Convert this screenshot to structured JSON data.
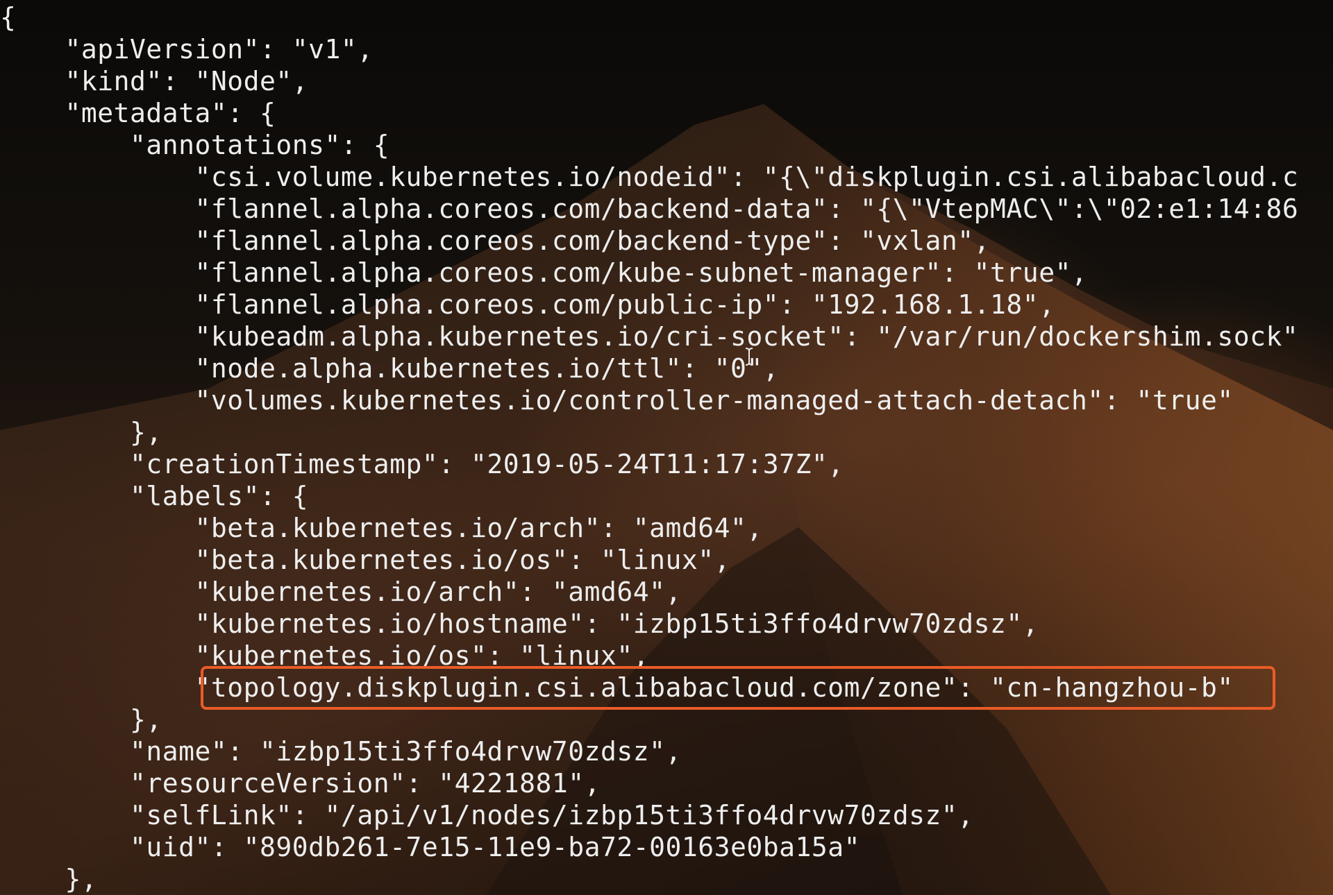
{
  "terminal": {
    "lines": [
      "{",
      "    \"apiVersion\": \"v1\",",
      "    \"kind\": \"Node\",",
      "    \"metadata\": {",
      "        \"annotations\": {",
      "            \"csi.volume.kubernetes.io/nodeid\": \"{\\\"diskplugin.csi.alibabacloud.c",
      "            \"flannel.alpha.coreos.com/backend-data\": \"{\\\"VtepMAC\\\":\\\"02:e1:14:86",
      "            \"flannel.alpha.coreos.com/backend-type\": \"vxlan\",",
      "            \"flannel.alpha.coreos.com/kube-subnet-manager\": \"true\",",
      "            \"flannel.alpha.coreos.com/public-ip\": \"192.168.1.18\",",
      "            \"kubeadm.alpha.kubernetes.io/cri-socket\": \"/var/run/dockershim.sock\"",
      "            \"node.alpha.kubernetes.io/ttl\": \"0\",",
      "            \"volumes.kubernetes.io/controller-managed-attach-detach\": \"true\"",
      "        },",
      "        \"creationTimestamp\": \"2019-05-24T11:17:37Z\",",
      "        \"labels\": {",
      "            \"beta.kubernetes.io/arch\": \"amd64\",",
      "            \"beta.kubernetes.io/os\": \"linux\",",
      "            \"kubernetes.io/arch\": \"amd64\",",
      "            \"kubernetes.io/hostname\": \"izbp15ti3ffo4drvw70zdsz\",",
      "            \"kubernetes.io/os\": \"linux\",",
      "            \"topology.diskplugin.csi.alibabacloud.com/zone\": \"cn-hangzhou-b\"",
      "        },",
      "        \"name\": \"izbp15ti3ffo4drvw70zdsz\",",
      "        \"resourceVersion\": \"4221881\",",
      "        \"selfLink\": \"/api/v1/nodes/izbp15ti3ffo4drvw70zdsz\",",
      "        \"uid\": \"890db261-7e15-11e9-ba72-00163e0ba15a\"",
      "    },"
    ],
    "highlight_color": "#ea5b28",
    "cursor_icon": "text-cursor-icon"
  }
}
